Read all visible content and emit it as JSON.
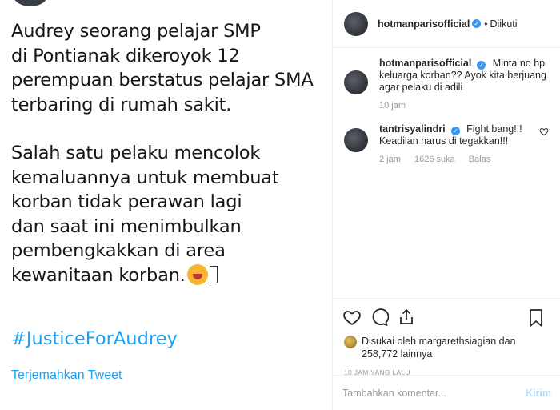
{
  "tweet": {
    "paragraph1": "Audrey seorang pelajar SMP\ndi Pontianak dikeroyok 12\nperempuan berstatus pelajar SMA\nterbaring di rumah sakit.",
    "paragraph2": "Salah satu pelaku mencolok\nkemaluannya untuk membuat\nkorban tidak perawan lagi\ndan saat ini menimbulkan\npembengkakkan di area\nkewanitaan korban.",
    "hashtag": "#JusticeForAudrey",
    "translate_label": "Terjemahkan Tweet",
    "emojis": [
      "crying-face-emoji",
      "missing-glyph-box"
    ]
  },
  "header": {
    "username": "hotmanparisofficial",
    "follow_status": "Diikuti"
  },
  "comments": [
    {
      "username": "hotmanparisofficial",
      "text": "Minta no hp keluarga korban?? Ayok kita berjuang agar pelaku di adili",
      "time": "10 jam"
    },
    {
      "username": "tantrisyalindri",
      "text": "Fight bang!!! Keadilan harus di tegakkan!!!",
      "time": "2 jam",
      "likes": "1626 suka",
      "reply": "Balas"
    }
  ],
  "likes": {
    "text": "Disukai oleh margarethsiagian dan 258,772 lainnya"
  },
  "timestamp": "10 JAM YANG LALU",
  "add_comment": {
    "placeholder": "Tambahkan komentar...",
    "post_label": "Kirim"
  },
  "colors": {
    "link": "#1da1f2",
    "verified": "#3897f0",
    "muted": "#999999",
    "post_disabled": "#b2dffc"
  }
}
